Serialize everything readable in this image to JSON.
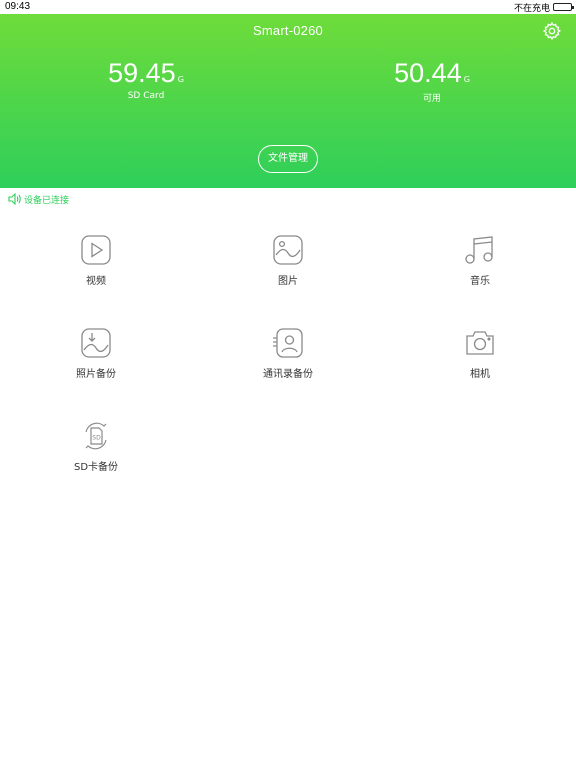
{
  "status": {
    "time": "09:43",
    "charging": "不在充电"
  },
  "header": {
    "device_name": "Smart-0260",
    "sd": {
      "value": "59.45",
      "unit": "G",
      "label": "SD Card"
    },
    "free": {
      "value": "50.44",
      "unit": "G",
      "label": "可用"
    },
    "file_button": "文件管理"
  },
  "connection": {
    "text": "设备已连接"
  },
  "tiles": [
    {
      "label": "视频",
      "icon": "video-icon"
    },
    {
      "label": "图片",
      "icon": "image-icon"
    },
    {
      "label": "音乐",
      "icon": "music-icon"
    },
    {
      "label": "照片备份",
      "icon": "photo-backup-icon"
    },
    {
      "label": "通讯录备份",
      "icon": "contacts-backup-icon"
    },
    {
      "label": "相机",
      "icon": "camera-icon"
    },
    {
      "label": "SD卡备份",
      "icon": "sd-backup-icon"
    }
  ],
  "colors": {
    "accent": "#2ecf5a",
    "header_top": "#6fdc3a",
    "icon": "#8a8a8a"
  }
}
